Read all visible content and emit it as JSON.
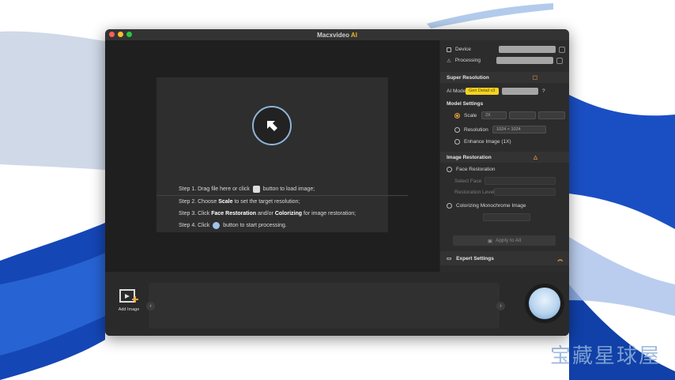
{
  "window": {
    "title_prefix": "Macxvideo",
    "title_suffix": "AI",
    "colors": {
      "close": "#ff5f57",
      "minimize": "#febc2e",
      "zoom": "#28c840",
      "accent": "#f2a43a"
    }
  },
  "preview": {
    "upload_icon": "upload-arrow-icon",
    "steps": {
      "s1_a": "Step 1. Drag file here or click",
      "s1_b": "button to load image;",
      "s2_a": "Step 2. Choose",
      "s2_b": "Scale",
      "s2_c": "to set the target resolution;",
      "s3_a": "Step 3. Click",
      "s3_b": "Face Restoration",
      "s3_c": "and/or",
      "s3_d": "Colorizing",
      "s3_e": "for image restoration;",
      "s4_a": "Step 4. Click",
      "s4_b": "button to start processing."
    }
  },
  "panel": {
    "device_label": "Device",
    "processing_label": "Processing",
    "super_resolution": "Super Resolution",
    "ai_model_label": "AI Model",
    "ai_model_value": "Gen Detail v3",
    "model_settings": "Model Settings",
    "scale_label": "Scale",
    "scale_value": "2X",
    "resolution_label": "Resolution",
    "resolution_value": "1024 × 1024",
    "enhance_label": "Enhance Image (1X)",
    "image_restoration": "Image Restoration",
    "face_restoration": "Face Restoration",
    "select_face": "Select Face",
    "restoration_level": "Restoration Level",
    "colorizing": "Colorizing Monochrome Image",
    "apply_all": "Apply to All",
    "expert_settings": "Expert Settings"
  },
  "bottom": {
    "add_image": "Add Image",
    "prev": "‹",
    "next": "›"
  },
  "watermark": "宝藏星球屋"
}
